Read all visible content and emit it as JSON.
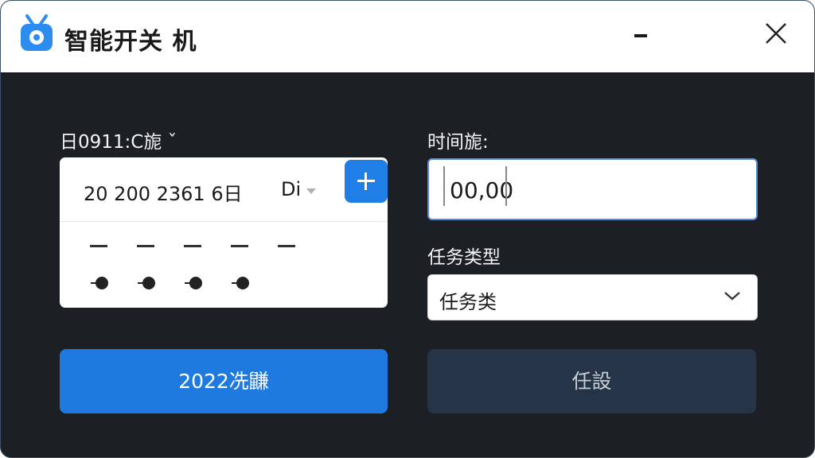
{
  "app": {
    "title": "智能开关 机",
    "icon": "tv-icon",
    "accent": "#1f7fe6"
  },
  "window_controls": {
    "minimize_icon": "minimize-icon",
    "close_icon": "close-icon"
  },
  "schedule": {
    "date_label": "日0911:C旎 ˇ",
    "date_value": "20 200 2361 6日",
    "dow_value": "Di",
    "add_icon": "plus-icon"
  },
  "time": {
    "label": "时间旎:",
    "value": "00,00"
  },
  "task_type": {
    "label": "任务类型",
    "selected": "任务类"
  },
  "actions": {
    "primary_label": "2022冼鼸",
    "secondary_label": "任設"
  }
}
